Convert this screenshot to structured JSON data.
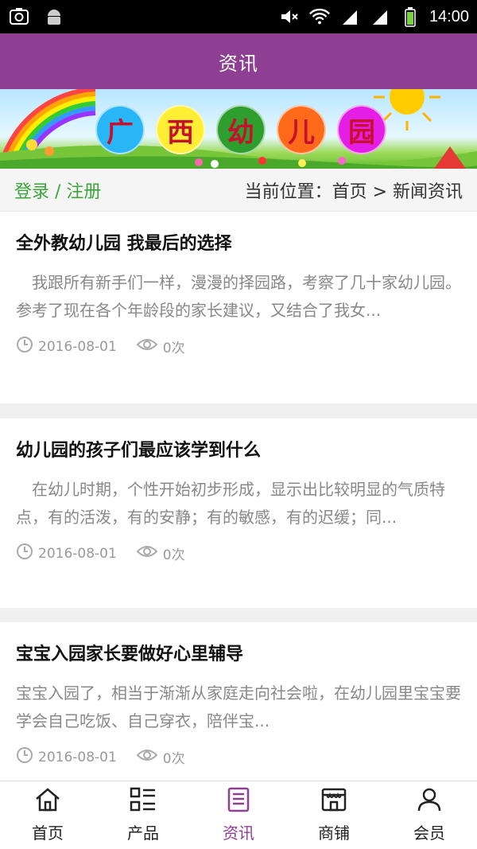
{
  "status_bar": {
    "time": "14:00"
  },
  "header": {
    "title": "资讯"
  },
  "banner": {
    "chars": [
      "广",
      "西",
      "幼",
      "儿",
      "园"
    ],
    "circle_colors": [
      "#29b6f6",
      "#ffee33",
      "#2e9e2e",
      "#ff6a1a",
      "#e51ee5"
    ]
  },
  "crumb": {
    "auth": "登录 / 注册",
    "location": "当前位置：首页 > 新闻资讯"
  },
  "articles": [
    {
      "title": "全外教幼儿园 我最后的选择",
      "desc": "　我跟所有新手们一样，漫漫的择园路，考察了几十家幼儿园。参考了现在各个年龄段的家长建议，又结合了我女...",
      "date": "2016-08-01",
      "views": "0次"
    },
    {
      "title": "幼儿园的孩子们最应该学到什么",
      "desc": "　在幼儿时期，个性开始初步形成，显示出比较明显的气质特点，有的活泼，有的安静；有的敏感，有的迟缓；同...",
      "date": "2016-08-01",
      "views": "0次"
    },
    {
      "title": "宝宝入园家长要做好心里辅导",
      "desc": "宝宝入园了，相当于渐渐从家庭走向社会啦，在幼儿园里宝宝要学会自己吃饭、自己穿衣，陪伴宝...",
      "date": "2016-08-01",
      "views": "0次"
    }
  ],
  "tabs": [
    {
      "label": "首页",
      "icon": "home-icon"
    },
    {
      "label": "产品",
      "icon": "grid-list-icon"
    },
    {
      "label": "资讯",
      "icon": "news-icon",
      "active": true
    },
    {
      "label": "商铺",
      "icon": "store-icon"
    },
    {
      "label": "会员",
      "icon": "user-icon"
    }
  ],
  "colors": {
    "primary": "#8e3f94",
    "auth_green": "#3aa53a"
  }
}
